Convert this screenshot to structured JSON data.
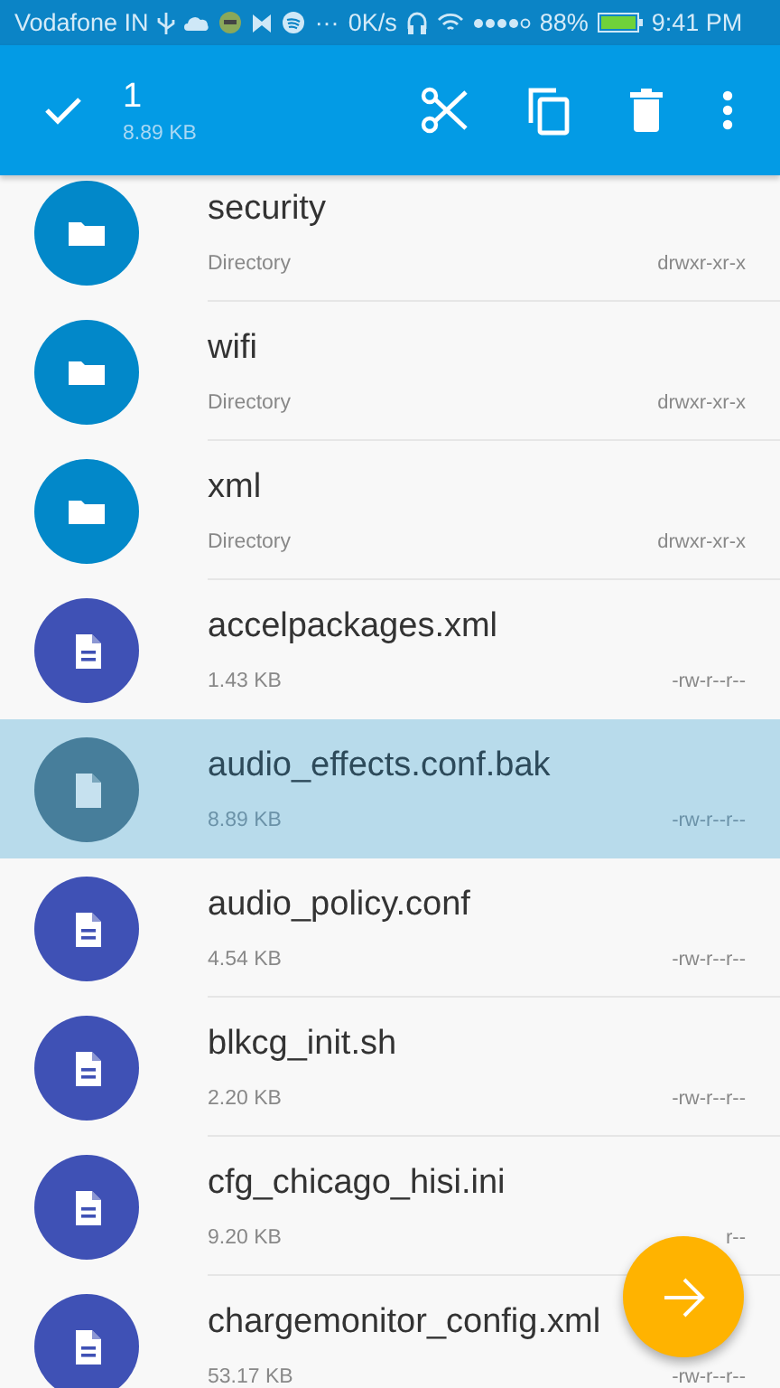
{
  "status_bar": {
    "carrier": "Vodafone IN",
    "more": "···",
    "speed": "0K/s",
    "battery_percent": "88%",
    "time": "9:41 PM"
  },
  "action_bar": {
    "count": "1",
    "size": "8.89 KB"
  },
  "files": [
    {
      "kind": "folder",
      "name": "security",
      "detail": "Directory",
      "permissions": "drwxr-xr-x",
      "selected": false
    },
    {
      "kind": "folder",
      "name": "wifi",
      "detail": "Directory",
      "permissions": "drwxr-xr-x",
      "selected": false
    },
    {
      "kind": "folder",
      "name": "xml",
      "detail": "Directory",
      "permissions": "drwxr-xr-x",
      "selected": false
    },
    {
      "kind": "file",
      "name": "accelpackages.xml",
      "detail": "1.43 KB",
      "permissions": "-rw-r--r--",
      "selected": false
    },
    {
      "kind": "file",
      "name": "audio_effects.conf.bak",
      "detail": "8.89 KB",
      "permissions": "-rw-r--r--",
      "selected": true
    },
    {
      "kind": "file",
      "name": "audio_policy.conf",
      "detail": "4.54 KB",
      "permissions": "-rw-r--r--",
      "selected": false
    },
    {
      "kind": "file",
      "name": "blkcg_init.sh",
      "detail": "2.20 KB",
      "permissions": "-rw-r--r--",
      "selected": false
    },
    {
      "kind": "file",
      "name": "cfg_chicago_hisi.ini",
      "detail": "9.20 KB",
      "permissions": "r--",
      "selected": false
    },
    {
      "kind": "file",
      "name": "chargemonitor_config.xml",
      "detail": "53.17 KB",
      "permissions": "-rw-r--r--",
      "selected": false
    }
  ]
}
